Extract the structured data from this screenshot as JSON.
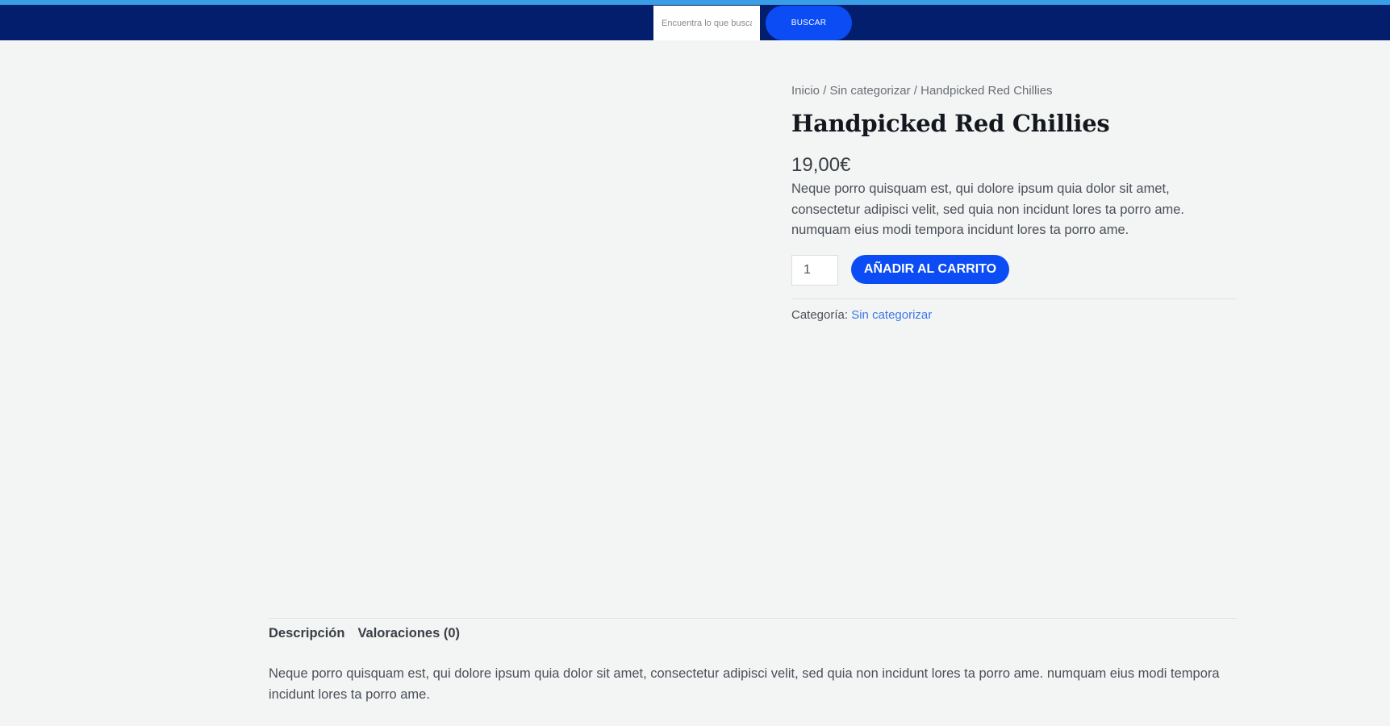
{
  "header": {
    "search_placeholder": "Encuentra lo que busca",
    "search_button": "BUSCAR"
  },
  "breadcrumb": {
    "home": "Inicio",
    "category": "Sin categorizar",
    "current": "Handpicked Red Chillies",
    "separator": "/"
  },
  "product": {
    "title": "Handpicked Red Chillies",
    "price": "19,00€",
    "short_description": "Neque porro quisquam est, qui dolore ipsum quia dolor sit amet, consectetur adipisci velit, sed quia non incidunt lores ta porro ame. numquam eius modi tempora incidunt lores ta porro ame.",
    "quantity": "1",
    "add_to_cart": "AÑADIR AL CARRITO",
    "category_label": "Categoría:",
    "category_value": "Sin categorizar"
  },
  "tabs": [
    {
      "label": "Descripción"
    },
    {
      "label": "Valoraciones (0)"
    }
  ],
  "description": {
    "text": "Neque porro quisquam est, qui dolore ipsum quia dolor sit amet, consectetur adipisci velit, sed quia non incidunt lores ta porro ame. numquam eius modi tempora incidunt lores ta porro ame."
  },
  "colors": {
    "header_bg": "#041e6e",
    "top_stripe": "#3a9ee6",
    "accent": "#0b4cf5",
    "link": "#3c77e8",
    "page_bg": "#f3f5f4"
  }
}
